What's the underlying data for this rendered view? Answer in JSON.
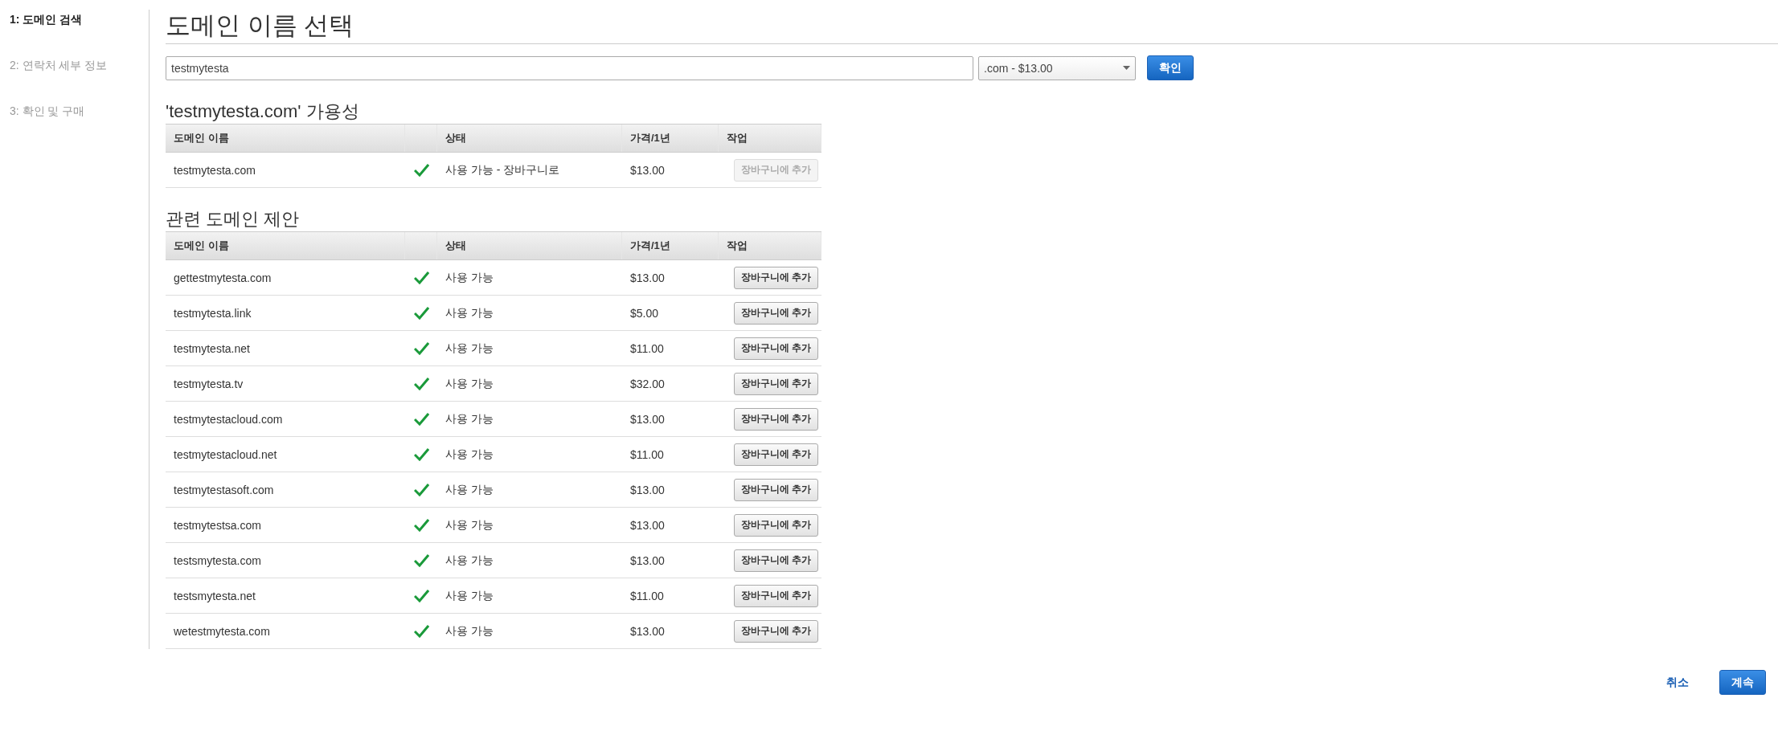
{
  "steps": [
    {
      "label": "1: 도메인 검색",
      "selected": true
    },
    {
      "label": "2: 연락처 세부 정보",
      "selected": false
    },
    {
      "label": "3: 확인 및 구매",
      "selected": false
    }
  ],
  "title": "도메인 이름 선택",
  "search": {
    "value": "testmytesta",
    "tld": ".com - $13.00",
    "button": "확인"
  },
  "availability": {
    "heading": "'testmytesta.com' 가용성",
    "columns": [
      "도메인 이름",
      "상태",
      "가격/1년",
      "작업"
    ],
    "rows": [
      {
        "domain": "testmytesta.com",
        "status": "사용 가능 - 장바구니로",
        "price": "$13.00",
        "action": "장바구니에 추가",
        "disabled": true
      }
    ]
  },
  "related": {
    "heading": "관련 도메인 제안",
    "columns": [
      "도메인 이름",
      "상태",
      "가격/1년",
      "작업"
    ],
    "rows": [
      {
        "domain": "gettestmytesta.com",
        "status": "사용 가능",
        "price": "$13.00",
        "action": "장바구니에 추가",
        "disabled": false
      },
      {
        "domain": "testmytesta.link",
        "status": "사용 가능",
        "price": "$5.00",
        "action": "장바구니에 추가",
        "disabled": false
      },
      {
        "domain": "testmytesta.net",
        "status": "사용 가능",
        "price": "$11.00",
        "action": "장바구니에 추가",
        "disabled": false
      },
      {
        "domain": "testmytesta.tv",
        "status": "사용 가능",
        "price": "$32.00",
        "action": "장바구니에 추가",
        "disabled": false
      },
      {
        "domain": "testmytestacloud.com",
        "status": "사용 가능",
        "price": "$13.00",
        "action": "장바구니에 추가",
        "disabled": false
      },
      {
        "domain": "testmytestacloud.net",
        "status": "사용 가능",
        "price": "$11.00",
        "action": "장바구니에 추가",
        "disabled": false
      },
      {
        "domain": "testmytestasoft.com",
        "status": "사용 가능",
        "price": "$13.00",
        "action": "장바구니에 추가",
        "disabled": false
      },
      {
        "domain": "testmytestsa.com",
        "status": "사용 가능",
        "price": "$13.00",
        "action": "장바구니에 추가",
        "disabled": false
      },
      {
        "domain": "testsmytesta.com",
        "status": "사용 가능",
        "price": "$13.00",
        "action": "장바구니에 추가",
        "disabled": false
      },
      {
        "domain": "testsmytesta.net",
        "status": "사용 가능",
        "price": "$11.00",
        "action": "장바구니에 추가",
        "disabled": false
      },
      {
        "domain": "wetestmytesta.com",
        "status": "사용 가능",
        "price": "$13.00",
        "action": "장바구니에 추가",
        "disabled": false
      }
    ]
  },
  "footer": {
    "cancel": "취소",
    "continue": "계속"
  }
}
